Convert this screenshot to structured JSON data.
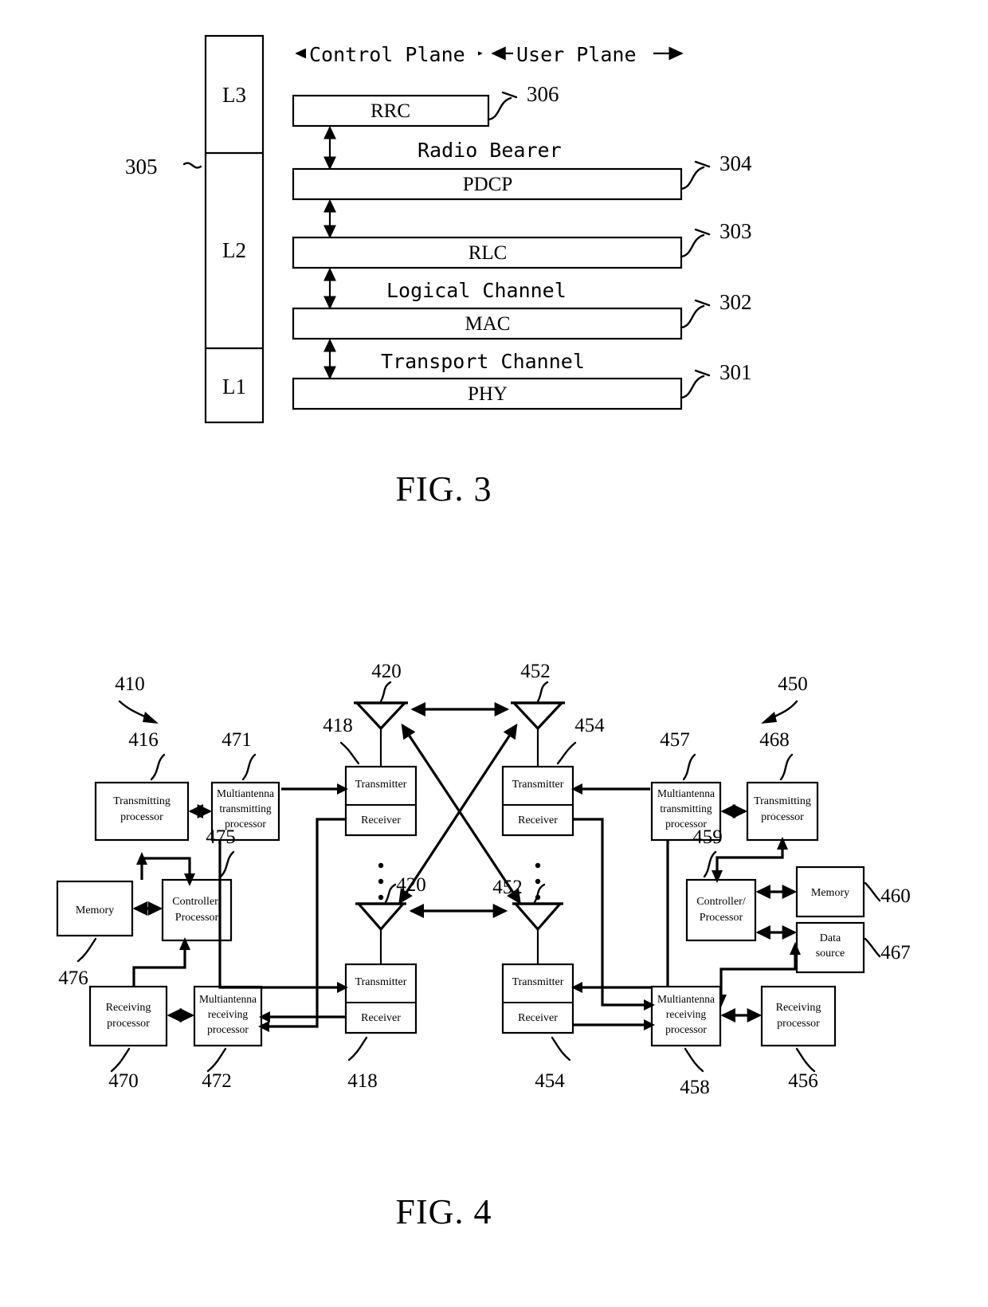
{
  "figure3": {
    "caption": "FIG. 3",
    "plane_labels": {
      "control": "Control Plane",
      "user": "User Plane"
    },
    "stack_ref": "305",
    "layers": [
      {
        "name": "L3"
      },
      {
        "name": "L2"
      },
      {
        "name": "L1"
      }
    ],
    "protocol_boxes": [
      {
        "label": "RRC",
        "ref": "306"
      },
      {
        "label": "PDCP",
        "ref": "304"
      },
      {
        "label": "RLC",
        "ref": "303"
      },
      {
        "label": "MAC",
        "ref": "302"
      },
      {
        "label": "PHY",
        "ref": "301"
      }
    ],
    "interface_labels": [
      {
        "label": "Radio Bearer"
      },
      {
        "label": "Logical Channel"
      },
      {
        "label": "Transport Channel"
      }
    ]
  },
  "figure4": {
    "caption": "FIG. 4",
    "device_refs": {
      "left": "410",
      "right": "450"
    },
    "left": {
      "transmitting_processor": {
        "label_line1": "Transmitting",
        "label_line2": "processor",
        "ref": "416"
      },
      "multiantenna_transmitting_processor": {
        "label_line1": "Multiantenna",
        "label_line2": "transmitting",
        "label_line3": "processor",
        "ref": "471"
      },
      "memory": {
        "label": "Memory",
        "ref": "476"
      },
      "controller_processor": {
        "label_line1": "Controller/",
        "label_line2": "Processor",
        "ref": "475"
      },
      "receiving_processor": {
        "label_line1": "Receiving",
        "label_line2": "processor",
        "ref": "470"
      },
      "multiantenna_receiving_processor": {
        "label_line1": "Multiantenna",
        "label_line2": "receiving",
        "label_line3": "processor",
        "ref": "472"
      },
      "transceivers": [
        {
          "transmitter": "Transmitter",
          "receiver": "Receiver",
          "ref": "418",
          "antenna_ref": "420"
        },
        {
          "transmitter": "Transmitter",
          "receiver": "Receiver",
          "ref": "418",
          "antenna_ref": "420"
        }
      ]
    },
    "right": {
      "transmitting_processor": {
        "label_line1": "Transmitting",
        "label_line2": "processor",
        "ref": "468"
      },
      "multiantenna_transmitting_processor": {
        "label_line1": "Multiantenna",
        "label_line2": "transmitting",
        "label_line3": "processor",
        "ref": "457"
      },
      "memory": {
        "label": "Memory",
        "ref": "460"
      },
      "data_source": {
        "label_line1": "Data",
        "label_line2": "source",
        "ref": "467"
      },
      "controller_processor": {
        "label_line1": "Controller/",
        "label_line2": "Processor",
        "ref": "459"
      },
      "receiving_processor": {
        "label_line1": "Receiving",
        "label_line2": "processor",
        "ref": "456"
      },
      "multiantenna_receiving_processor": {
        "label_line1": "Multiantenna",
        "label_line2": "receiving",
        "label_line3": "processor",
        "ref": "458"
      },
      "transceivers": [
        {
          "transmitter": "Transmitter",
          "receiver": "Receiver",
          "ref": "454",
          "antenna_ref": "452"
        },
        {
          "transmitter": "Transmitter",
          "receiver": "Receiver",
          "ref": "454",
          "antenna_ref": "452"
        }
      ]
    },
    "ellipsis_glyph": "⋮"
  },
  "colors": {
    "ink": "#000000",
    "paper": "#ffffff"
  }
}
